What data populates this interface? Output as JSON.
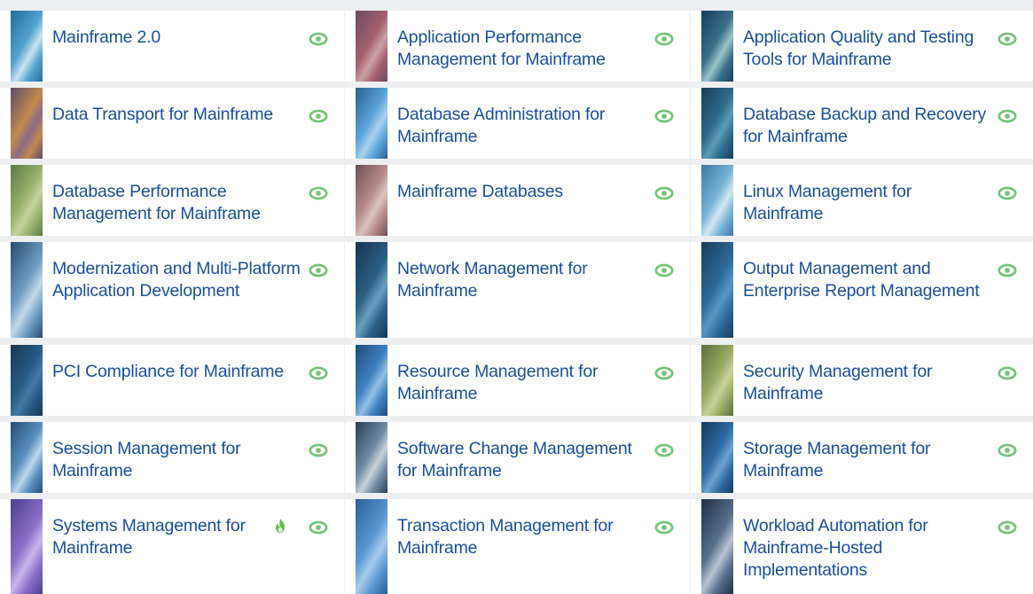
{
  "colors": {
    "title_text": "#1b4f9c",
    "eye_icon": "#77c47a",
    "flame_icon": "#58c04a",
    "card_bg": "#ffffff",
    "page_bg": "#eceef0"
  },
  "cards": [
    {
      "title": "Mainframe 2.0",
      "icon": "eye-icon",
      "thumb": [
        "#1f6d9a",
        "#53a2cf",
        "#c7e3f0"
      ]
    },
    {
      "title": "Application Performance Management for Mainframe",
      "icon": "eye-icon",
      "thumb": [
        "#6b4b63",
        "#a45f6e",
        "#caa2a7"
      ]
    },
    {
      "title": "Application Quality and Testing Tools for Mainframe",
      "icon": "eye-icon",
      "thumb": [
        "#163d5a",
        "#3b6f8a",
        "#9ac4c9"
      ]
    },
    {
      "title": "Data Transport for Mainframe",
      "icon": "eye-icon",
      "thumb": [
        "#5e4c6a",
        "#c08a4e",
        "#8d6b86"
      ]
    },
    {
      "title": "Database Administration for Mainframe",
      "icon": "eye-icon",
      "thumb": [
        "#2a5f8f",
        "#5ba3d9",
        "#a9d1ee"
      ]
    },
    {
      "title": "Database Backup and Recovery for Mainframe",
      "icon": "eye-icon",
      "thumb": [
        "#1a3e56",
        "#2f6a8c",
        "#5e9cb6"
      ]
    },
    {
      "title": "Database Performance Management for Mainframe",
      "icon": "eye-icon",
      "thumb": [
        "#5a7a46",
        "#9ab06c",
        "#c7d3a1"
      ]
    },
    {
      "title": "Mainframe Databases",
      "icon": "eye-icon",
      "thumb": [
        "#6d4e55",
        "#b78a8c",
        "#d9c3c0"
      ]
    },
    {
      "title": "Linux Management for Mainframe",
      "icon": "eye-icon",
      "thumb": [
        "#3b78a6",
        "#78b3d6",
        "#d2e7f2"
      ]
    },
    {
      "title": "Modernization and Multi-Platform Application Development",
      "icon": "eye-icon",
      "thumb": [
        "#274a6d",
        "#6f9dc3",
        "#c2d9e8"
      ]
    },
    {
      "title": "Network Management for Mainframe",
      "icon": "eye-icon",
      "thumb": [
        "#17344f",
        "#2c5f86",
        "#6a9fc4"
      ]
    },
    {
      "title": "Output Management and Enterprise Report Management",
      "icon": "eye-icon",
      "thumb": [
        "#1a3c5c",
        "#2e6a99",
        "#5a95c2"
      ]
    },
    {
      "title": "PCI Compliance for Mainframe",
      "icon": "eye-icon",
      "thumb": [
        "#163652",
        "#285a82",
        "#447aa6"
      ]
    },
    {
      "title": "Resource Management for Mainframe",
      "icon": "eye-icon",
      "thumb": [
        "#1e4a7a",
        "#3f80bf",
        "#92c0e6"
      ]
    },
    {
      "title": "Security Management for Mainframe",
      "icon": "eye-icon",
      "thumb": [
        "#5b6e3e",
        "#98aa63",
        "#c9d29a"
      ]
    },
    {
      "title": "Session Management for Mainframe",
      "icon": "eye-icon",
      "thumb": [
        "#244b73",
        "#5a8fc0",
        "#bcd7ec"
      ]
    },
    {
      "title": "Software Change Management for Mainframe",
      "icon": "eye-icon",
      "thumb": [
        "#2b3f57",
        "#6f8aa3",
        "#c9d2da"
      ]
    },
    {
      "title": "Storage Management for Mainframe",
      "icon": "eye-icon",
      "thumb": [
        "#173a5e",
        "#2f6aa3",
        "#6da2d0"
      ]
    },
    {
      "title": "Systems Management for Mainframe",
      "icon": "eye-icon",
      "flame": "flame-icon",
      "thumb": [
        "#4a3f8e",
        "#8a6fc9",
        "#c6b6ea"
      ]
    },
    {
      "title": "Transaction Management for Mainframe",
      "icon": "eye-icon",
      "thumb": [
        "#2a5f98",
        "#5a97d3",
        "#a8cbed"
      ]
    },
    {
      "title": "Workload Automation for Mainframe-Hosted Implementations",
      "icon": "eye-icon",
      "thumb": [
        "#1f2f44",
        "#56708e",
        "#b8c4d2"
      ]
    }
  ]
}
